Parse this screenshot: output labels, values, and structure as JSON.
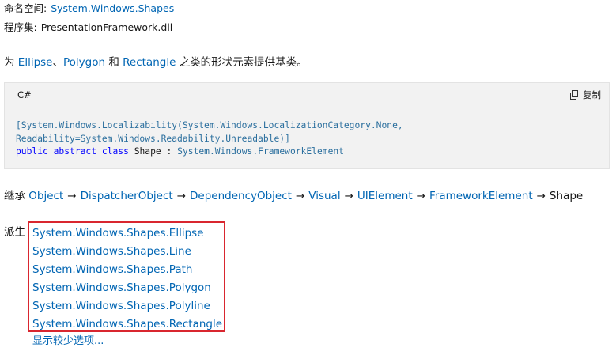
{
  "meta": {
    "namespace_label": "命名空间:",
    "namespace_value": "System.Windows.Shapes",
    "assembly_label": "程序集:",
    "assembly_value": "PresentationFramework.dll"
  },
  "summary": {
    "prefix": "为",
    "link_ellipse": "Ellipse",
    "sep1": "、",
    "link_polygon": "Polygon",
    "and": "和",
    "link_rectangle": "Rectangle",
    "suffix": "之类的形状元素提供基类。"
  },
  "code": {
    "language": "C#",
    "copy_label": "复制",
    "line1": "[System.Windows.Localizability(System.Windows.LocalizationCategory.None,",
    "line2": "Readability=System.Windows.Readability.Unreadable)]",
    "kw_public": "public",
    "kw_abstract": "abstract",
    "kw_class": "class",
    "class_name": "Shape",
    "colon": ":",
    "base_type": "System.Windows.FrameworkElement"
  },
  "inheritance": {
    "label": "继承",
    "arrow": "→",
    "chain": [
      "Object",
      "DispatcherObject",
      "DependencyObject",
      "Visual",
      "UIElement",
      "FrameworkElement"
    ],
    "current": "Shape"
  },
  "derived": {
    "label": "派生",
    "items": [
      "System.Windows.Shapes.Ellipse",
      "System.Windows.Shapes.Line",
      "System.Windows.Shapes.Path",
      "System.Windows.Shapes.Polygon",
      "System.Windows.Shapes.Polyline",
      "System.Windows.Shapes.Rectangle"
    ],
    "show_less": "显示较少选项..."
  },
  "colors": {
    "link": "#0065b3",
    "highlight_border": "#d9262f",
    "code_bg": "#f2f2f2"
  }
}
